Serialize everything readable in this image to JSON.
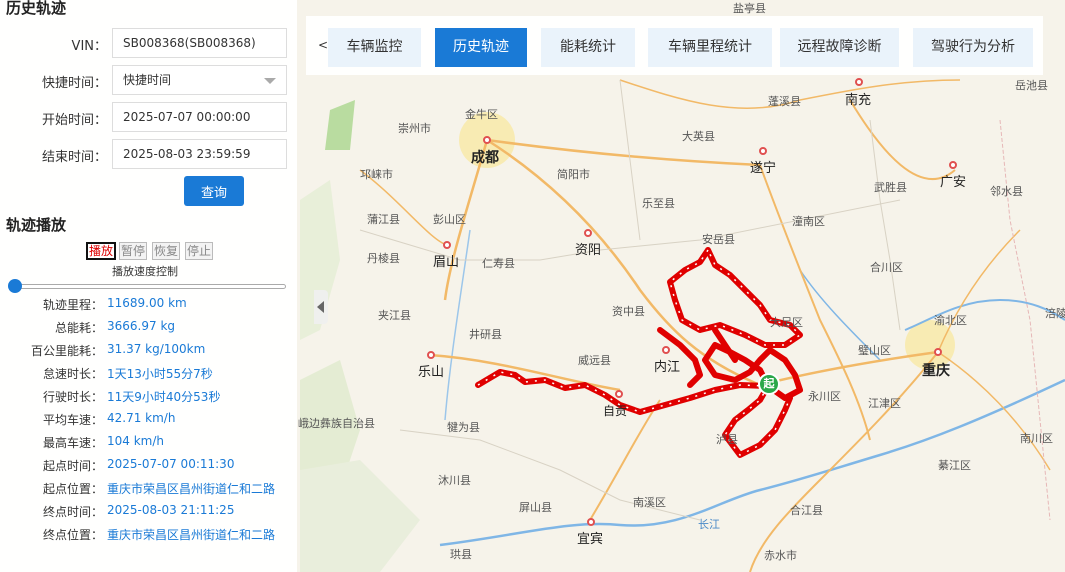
{
  "sidebar": {
    "title": "历史轨迹",
    "form": {
      "vin_label": "VIN：",
      "vin_value": "SB008368(SB008368)",
      "quick_time_label": "快捷时间：",
      "quick_time_value": "快捷时间",
      "start_label": "开始时间：",
      "start_value": "2025-07-07 00:00:00",
      "end_label": "结束时间：",
      "end_value": "2025-08-03 23:59:59",
      "query_label": "查询"
    },
    "playback": {
      "title": "轨迹播放",
      "play_label": "播放",
      "pause_label": "暂停",
      "resume_label": "恢复",
      "stop_label": "停止",
      "speed_label": "播放速度控制",
      "speed_level": 0
    },
    "stats": [
      {
        "label": "轨迹里程：",
        "value": "11689.00 km"
      },
      {
        "label": "总能耗：",
        "value": "3666.97 kg"
      },
      {
        "label": "百公里能耗：",
        "value": "31.37 kg/100km"
      },
      {
        "label": "怠速时长：",
        "value": "1天13小时55分7秒"
      },
      {
        "label": "行驶时长：",
        "value": "11天9小时40分53秒"
      },
      {
        "label": "平均车速：",
        "value": "42.71 km/h"
      },
      {
        "label": "最高车速：",
        "value": "104 km/h"
      },
      {
        "label": "起点时间：",
        "value": "2025-07-07 00:11:30"
      },
      {
        "label": "起点位置：",
        "value": "重庆市荣昌区昌州街道仁和二路"
      },
      {
        "label": "终点时间：",
        "value": "2025-08-03 21:11:25"
      },
      {
        "label": "终点位置：",
        "value": "重庆市荣昌区昌州街道仁和二路"
      }
    ]
  },
  "tabs": {
    "prev": "<",
    "items": [
      {
        "label": "车辆监控"
      },
      {
        "label": "历史轨迹"
      },
      {
        "label": "能耗统计"
      },
      {
        "label": "车辆里程统计"
      },
      {
        "label": "远程故障诊断"
      },
      {
        "label": "驾驶行为分析"
      }
    ],
    "active_index": 1
  },
  "map": {
    "start_marker": "起",
    "cities": [
      {
        "name": "成都"
      },
      {
        "name": "重庆"
      },
      {
        "name": "内江"
      },
      {
        "name": "乐山"
      },
      {
        "name": "宜宾"
      },
      {
        "name": "资阳"
      },
      {
        "name": "眉山"
      },
      {
        "name": "遂宁"
      },
      {
        "name": "南充"
      },
      {
        "name": "广安"
      },
      {
        "name": "自贡"
      }
    ],
    "places": [
      {
        "name": "金牛区"
      },
      {
        "name": "崇州市"
      },
      {
        "name": "邛崃市"
      },
      {
        "name": "蒲江县"
      },
      {
        "name": "丹棱县"
      },
      {
        "name": "夹江县"
      },
      {
        "name": "井研县"
      },
      {
        "name": "仁寿县"
      },
      {
        "name": "简阳市"
      },
      {
        "name": "乐至县"
      },
      {
        "name": "安岳县"
      },
      {
        "name": "大足区"
      },
      {
        "name": "永川区"
      },
      {
        "name": "江津区"
      },
      {
        "name": "璧山区"
      },
      {
        "name": "渝北区"
      },
      {
        "name": "合川区"
      },
      {
        "name": "潼南区"
      },
      {
        "name": "武胜县"
      },
      {
        "name": "邻水县"
      },
      {
        "name": "蓬溪县"
      },
      {
        "name": "大英县"
      },
      {
        "name": "威远县"
      },
      {
        "name": "资中县"
      },
      {
        "name": "犍为县"
      },
      {
        "name": "沐川县"
      },
      {
        "name": "屏山县"
      },
      {
        "name": "南溪区"
      },
      {
        "name": "合江县"
      },
      {
        "name": "赤水市"
      },
      {
        "name": "綦江区"
      },
      {
        "name": "南川区"
      },
      {
        "name": "长江"
      },
      {
        "name": "峨边彝族自治县"
      },
      {
        "name": "彭山区"
      },
      {
        "name": "盐亭县"
      },
      {
        "name": "涪陵"
      },
      {
        "name": "岳池县"
      },
      {
        "name": "泸县"
      },
      {
        "name": "珙县"
      }
    ]
  },
  "colors": {
    "accent": "#1a7ad6",
    "track": "#e00000",
    "start_marker": "#2aa84a"
  }
}
